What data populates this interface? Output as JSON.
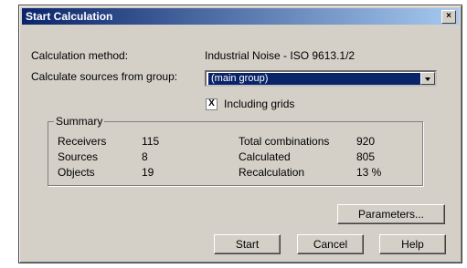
{
  "dialog": {
    "title": "Start Calculation",
    "close_label": "×"
  },
  "form": {
    "method_label": "Calculation method:",
    "method_value": "Industrial Noise - ISO 9613.1/2",
    "group_label": "Calculate sources from group:",
    "group_value": "(main group)",
    "including_grids_label": "Including grids",
    "including_grids_checked_mark": "X"
  },
  "summary": {
    "title": "Summary",
    "left": [
      {
        "label": "Receivers",
        "value": "115"
      },
      {
        "label": "Sources",
        "value": "8"
      },
      {
        "label": "Objects",
        "value": "19"
      }
    ],
    "right": [
      {
        "label": "Total combinations",
        "value": "920"
      },
      {
        "label": "Calculated",
        "value": "805"
      },
      {
        "label": "Recalculation",
        "value": "13 %"
      }
    ]
  },
  "buttons": {
    "parameters": "Parameters...",
    "start": "Start",
    "cancel": "Cancel",
    "help": "Help"
  }
}
